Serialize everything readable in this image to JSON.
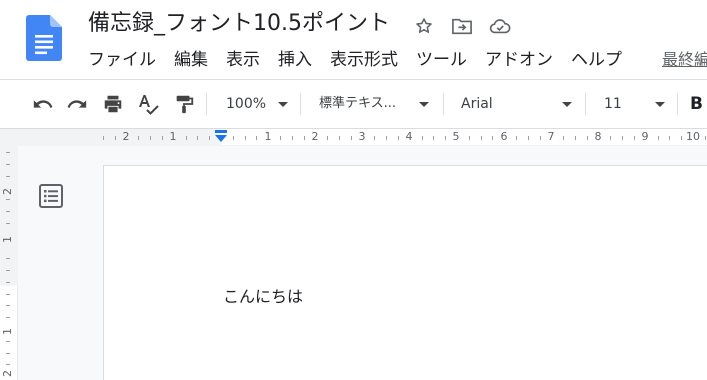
{
  "document": {
    "title": "備忘録_フォント10.5ポイント",
    "body_text": "こんにちは"
  },
  "menu": {
    "items": [
      "ファイル",
      "編集",
      "表示",
      "挿入",
      "表示形式",
      "ツール",
      "アドオン",
      "ヘルプ"
    ],
    "last_edit": "最終編"
  },
  "toolbar": {
    "zoom": "100%",
    "style": "標準テキス...",
    "font": "Arial",
    "font_size": "11",
    "bold_label": "B"
  },
  "ruler": {
    "labels": [
      "2",
      "1",
      "1",
      "2",
      "3",
      "4",
      "5",
      "6",
      "7",
      "8",
      "9",
      "10"
    ],
    "vertical_labels": [
      "2",
      "1",
      "1",
      "2"
    ]
  },
  "colors": {
    "docs_blue": "#4285f4",
    "indent_marker": "#1a73e8",
    "canvas_bg": "#f8f9fa"
  },
  "icons": {
    "logo": "google-docs-icon",
    "star": "star-icon",
    "move": "move-to-folder-icon",
    "cloud": "cloud-saved-icon",
    "undo": "undo-icon",
    "redo": "redo-icon",
    "print": "print-icon",
    "spellcheck": "spellcheck-icon",
    "paint_format": "paint-format-icon",
    "outline": "document-outline-icon"
  }
}
